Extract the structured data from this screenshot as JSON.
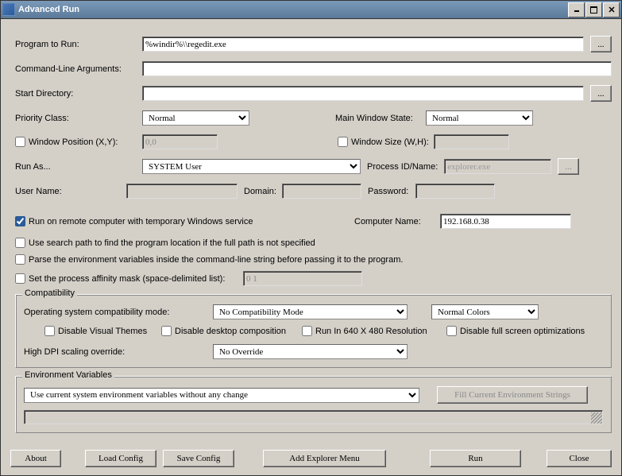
{
  "title": "Advanced Run",
  "labels": {
    "program_to_run": "Program to Run:",
    "cmdline_args": "Command-Line Arguments:",
    "start_dir": "Start Directory:",
    "priority_class": "Priority Class:",
    "main_window_state": "Main Window State:",
    "window_pos": "Window Position (X,Y):",
    "window_size": "Window Size (W,H):",
    "run_as": "Run As...",
    "process_id_name": "Process ID/Name:",
    "user_name": "User Name:",
    "domain": "Domain:",
    "password": "Password:",
    "computer_name": "Computer Name:",
    "os_compat_mode": "Operating system compatibility mode:",
    "high_dpi": "High DPI scaling override:"
  },
  "values": {
    "program_to_run": "%windir%\\\\regedit.exe",
    "cmdline_args": "",
    "start_dir": "",
    "priority_class": "Normal",
    "main_window_state": "Normal",
    "window_pos": "0,0",
    "window_size": "",
    "run_as": "SYSTEM User",
    "process_placeholder": "explorer.exe",
    "computer_name": "192.168.0.38",
    "affinity_value": "0 1",
    "compat_mode": "No Compatibility Mode",
    "colors": "Normal Colors",
    "dpi_override": "No Override",
    "env_mode": "Use current system environment variables without any change"
  },
  "checkboxes": {
    "remote_computer": "Run on remote computer with temporary Windows service",
    "use_search_path": "Use search path to find the program location if the full path is not specified",
    "parse_env": "Parse the environment variables inside the command-line string before passing it to the program.",
    "affinity": "Set the process affinity mask (space-delimited list):",
    "disable_visual_themes": "Disable Visual Themes",
    "disable_desktop_comp": "Disable desktop composition",
    "run_640": "Run In 640 X 480 Resolution",
    "disable_fullscreen": "Disable full screen optimizations"
  },
  "groups": {
    "compatibility": "Compatibility",
    "env_vars": "Environment Variables"
  },
  "buttons": {
    "browse": "...",
    "fill_env": "Fill Current Environment Strings",
    "about": "About",
    "load_config": "Load Config",
    "save_config": "Save Config",
    "add_explorer": "Add Explorer Menu",
    "run": "Run",
    "close": "Close"
  }
}
